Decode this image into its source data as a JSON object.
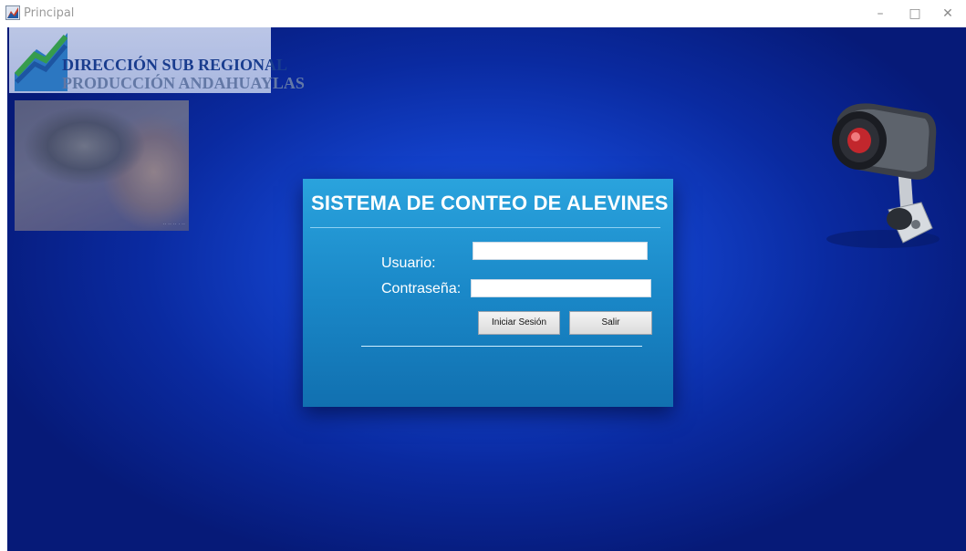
{
  "window": {
    "title": "Principal",
    "minimize_glyph": "–",
    "maximize_glyph": "□",
    "close_glyph": "✕"
  },
  "logo": {
    "line1": "DIRECCIÓN SUB REGIONAL",
    "line2": "PRODUCCIÓN ANDAHUAYLAS"
  },
  "photo": {
    "caption": "·· ·· ·· · ··"
  },
  "login": {
    "title": "SISTEMA DE CONTEO DE ALEVINES",
    "user_label": "Usuario:",
    "password_label": "Contraseña:",
    "user_value": "",
    "password_value": "",
    "login_button": "Iniciar Sesión",
    "exit_button": "Salir"
  },
  "colors": {
    "background": "#1240c8",
    "panel": "#1a88c8",
    "logo_text": "#1b3f8f"
  },
  "icons": [
    "app-icon",
    "logo-chart-icon",
    "security-camera-icon"
  ]
}
